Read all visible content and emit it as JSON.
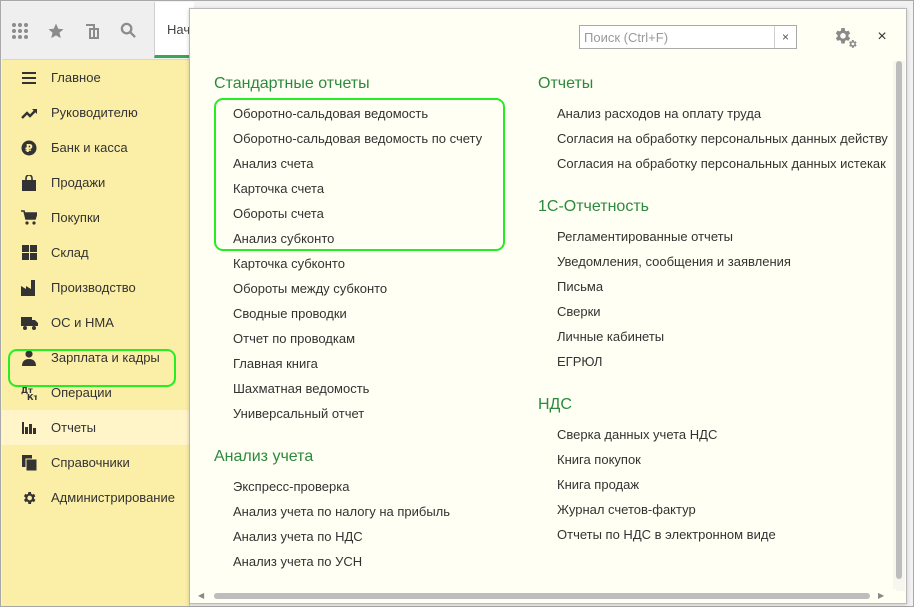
{
  "toolbar": {
    "icons": [
      "apps-grid-icon",
      "star-icon",
      "history-icon",
      "search-icon"
    ],
    "tab_label": "Нач"
  },
  "sidebar": {
    "items": [
      {
        "label": "Главное",
        "icon": "menu-lines-icon"
      },
      {
        "label": "Руководителю",
        "icon": "trend-icon"
      },
      {
        "label": "Банк и касса",
        "icon": "ruble-icon"
      },
      {
        "label": "Продажи",
        "icon": "bag-icon"
      },
      {
        "label": "Покупки",
        "icon": "cart-icon"
      },
      {
        "label": "Склад",
        "icon": "warehouse-icon"
      },
      {
        "label": "Производство",
        "icon": "factory-icon"
      },
      {
        "label": "ОС и НМА",
        "icon": "truck-icon"
      },
      {
        "label": "Зарплата и кадры",
        "icon": "person-icon"
      },
      {
        "label": "Операции",
        "icon": "dt-kt-icon"
      },
      {
        "label": "Отчеты",
        "icon": "bar-chart-icon",
        "active": true
      },
      {
        "label": "Справочники",
        "icon": "books-icon"
      },
      {
        "label": "Администрирование",
        "icon": "gear-icon"
      }
    ]
  },
  "panel": {
    "search_placeholder": "Поиск (Ctrl+F)",
    "clear_glyph": "×",
    "close_glyph": "×",
    "left_sections": [
      {
        "title": "Стандартные отчеты",
        "items": [
          "Оборотно-сальдовая ведомость",
          "Оборотно-сальдовая ведомость по счету",
          "Анализ счета",
          "Карточка счета",
          "Обороты счета",
          "Анализ субконто",
          "Карточка субконто",
          "Обороты между субконто",
          "Сводные проводки",
          "Отчет по проводкам",
          "Главная книга",
          "Шахматная ведомость",
          "Универсальный отчет"
        ]
      },
      {
        "title": "Анализ учета",
        "items": [
          "Экспресс-проверка",
          "Анализ учета по налогу на прибыль",
          "Анализ учета по НДС",
          "Анализ учета по УСН"
        ]
      }
    ],
    "right_sections": [
      {
        "title": "Отчеты",
        "items": [
          "Анализ расходов на оплату труда",
          "Согласия на обработку персональных данных действу",
          "Согласия на обработку персональных данных истекак"
        ]
      },
      {
        "title": "1С-Отчетность",
        "items": [
          "Регламентированные отчеты",
          "Уведомления, сообщения и заявления",
          "Письма",
          "Сверки",
          "Личные кабинеты",
          "ЕГРЮЛ"
        ]
      },
      {
        "title": "НДС",
        "items": [
          "Сверка данных учета НДС",
          "Книга покупок",
          "Книга продаж",
          "Журнал счетов-фактур",
          "Отчеты по НДС в электронном виде"
        ]
      }
    ]
  },
  "colors": {
    "sidebar_bg": "#fbeea6",
    "panel_bg": "#fffff3",
    "section_title": "#2c8a3e",
    "highlight": "#22ee22"
  }
}
